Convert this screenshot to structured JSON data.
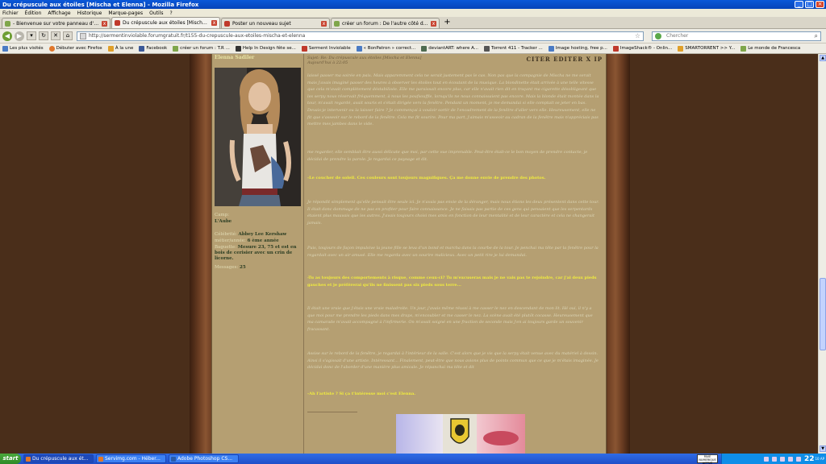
{
  "window": {
    "title": "Du crépuscule aux étoiles [Mischa et Elenna] - Mozilla Firefox",
    "min_label": "_",
    "max_label": "□",
    "close_label": "×"
  },
  "menu": [
    "Fichier",
    "Édition",
    "Affichage",
    "Historique",
    "Marque-pages",
    "Outils",
    "?"
  ],
  "tabs": [
    {
      "label": "- Bienvenue sur votre panneau d'adminis...",
      "active": false,
      "color": "#7fa64a"
    },
    {
      "label": "Du crépuscule aux étoiles [Mischa et Elen...",
      "active": true,
      "color": "#c0392b"
    },
    {
      "label": "Poster un nouveau sujet",
      "active": false,
      "color": "#c0392b"
    },
    {
      "label": "créer un forum : De l'autre côté du miroire",
      "active": false,
      "color": "#7fa64a"
    }
  ],
  "tab_close": "x",
  "new_tab": "+",
  "nav": {
    "back": "◀",
    "forward": "▶",
    "home": "⌂",
    "url": "http://sermentinviolable.forumgratuit.fr/t155-du-crepuscule-aux-etoiles-mischa-et-elenna",
    "star": "☆",
    "search_placeholder": "Chercher",
    "search_icon": "🔍"
  },
  "bookmarks": [
    {
      "label": "Les plus visités",
      "color": "#4a7bc4"
    },
    {
      "label": "Débuter avec Firefox",
      "color": "#e0762a"
    },
    {
      "label": "À la une",
      "color": "#e0a02a"
    },
    {
      "label": "Facebook",
      "color": "#3b5998"
    },
    {
      "label": "créer un forum : T.R ...",
      "color": "#7fa64a"
    },
    {
      "label": "Help In Design fête se...",
      "color": "#333333"
    },
    {
      "label": "Serment Inviolable",
      "color": "#c0392b"
    },
    {
      "label": "« BonPatron » correct...",
      "color": "#4a7bc4"
    },
    {
      "label": "deviantART: where A...",
      "color": "#4e6b50"
    },
    {
      "label": "Torrent 411 - Tracker ...",
      "color": "#555555"
    },
    {
      "label": "Image hosting, free p...",
      "color": "#4a7bc4"
    },
    {
      "label": "ImageShack® - Onlin...",
      "color": "#c0392b"
    },
    {
      "label": "SMARTORRENT >> Y...",
      "color": "#e0a02a"
    },
    {
      "label": "Le monde de Francesca",
      "color": "#7fa64a"
    }
  ],
  "profile": {
    "username": "Elenna Sadiler",
    "camp_label": "Camp:",
    "camp_value": "L'Aube",
    "celebrity_label": "Célébrité:",
    "celebrity_value": "Abbey Lee Kershaw",
    "year_label": "métier/année:",
    "year_value": "6 ème année",
    "wand_label": "Baguette:",
    "wand_value": "Mesure 23, 75 et est en bois de cerisier avec un crin de licorne.",
    "messages_label": "Messages:",
    "messages_value": "25"
  },
  "post": {
    "subject": "Sujet: Re: Du crépuscule aux étoiles [Mischa et Elenna]",
    "date": "Aujourd'hui à 22:05",
    "tools": "CITER EDITER X IP",
    "paragraphs": [
      "laissé passer ma soirée en paix. Mais apparemment cela ne serait justement pas le cas. Non pas que la compagnie de Mischa ne me serait mais j'avais imaginé passer des heures à observer les étoiles tout en écoutant de la musique. La blondinette était arrivée à une telle vitesse que cela m'avait complètement déstabilisée. Elle me paraissait encore plus, car elle n'avait rien dit en traçant ma cigarette désobligeant que les serpy nous réservait fréquemment, à nous les poufsouffle, lorsqu'ils ne nous connaissaient pas encore. Mais la blonde était montée dans la tour, m'avait regardé, avait souris et s'était dirigée vers la fenêtre. Pendant un moment, je me demandai si elle comptait se jeter en bas. Devais-je intervenir ou la laisser faire ? Je commençai à vouloir sortir de l'encadrement de la fenêtre d'aller vers elle. Heureusement, elle ne fit que s'asseoir sur le rebord de la fenêtre. Cela me fit sourire. Pour ma part, j'aimais m'asseoir au cadran de la fenêtre mais n'appréciais pas mettre mes jambes dans le vide.",
      "me regarder, elle semblait être aussi délicate que moi, par cette vue imprenable. Peut-être était-ce le bon moyen de prendre contacte, je décidai de prendre la parole. Je regardai ce paysage et dit.",
      "-Le coucher de soleil. Ces couleurs sont toujours magnifiques. Ça me donne envie de prendre des photos.",
      "Je répondit simplement qu'elle pensait être seule ici. Je n'avais pas envie de la déranger, mais nous étions les deux présentent dans cette tour. Il était donc dommage de ne pas en profiter pour faire connaissance. Je ne faisais pas partie de ces gens qui pensaient que les serpentards étaient plus mauvais que les autres. J'avais toujours choisi mes amis en fonction de leur mentalité et de leur caractère et cela ne changerait jamais.",
      "Puis, toujours de façon impulsive la jeune fille se leva d'un bond et marcha dans la courbe de la tour. Je penchai ma tête par la fenêtre pour la regardait avec un air amusé. Elle me regarda avec un sourire malicieux. Avec un petit rire je lui demandai.",
      "-Tu as toujours des comportements à risque, comme ceux-ci? Tu m'excuseras mais je ne vais pas te rejoindre, car j'ai deux pieds gauches et je préférerai qu'ils ne finissent pas six pieds sous terre...",
      "Il était une vraie que j'étais une vraie maladroite. Un jour, j'avais même réussi à me casser le nez en descendant de mon lit. Hé oui, il n'y a que moi pour me prendre les pieds dans mes draps, m'encoubler et me casser le nez. La scène avait été plutôt cocasse. Heureusement que ma camarade m'avait accompagné à l'infirmerie. On m'avait soigné en une fraction de seconde mais j'en ai toujours garde un souvenir fracassant.",
      "Assise sur le rebord de la fenêtre, je regardai à l'intérieur de la salle. C'est alors que je vis que la serpy était venue avec du matériel à dessin. Ainsi il s'agissait d'une artiste. Intéressant... Finalement, peut-être que nous avions plus de points commun que ce que je m'étais imaginée. Je décidai donc de l'aborder d'une manière plus amicale. Je répanchai ma tête et dit",
      "-Ah l'artiste ? Si ça t'intéresse moi c'est Elenna."
    ]
  },
  "taskbar": {
    "start": "start",
    "tasks": [
      {
        "label": "Du crépuscule aux ét...",
        "color": "#e0762a",
        "active": true
      },
      {
        "label": "Servimg.com - Héber...",
        "color": "#e0762a",
        "active": false
      },
      {
        "label": "Adobe Photoshop CS...",
        "color": "#2a5caa",
        "active": false
      }
    ],
    "lang": "PAVE NUMERIQUE ACTIVE",
    "clock": "22",
    "clock_suffix": "10 AP"
  },
  "colors": {
    "forum_bg": "#b59f72",
    "text": "#dcd6b7",
    "highlight": "#f2ee3c"
  }
}
